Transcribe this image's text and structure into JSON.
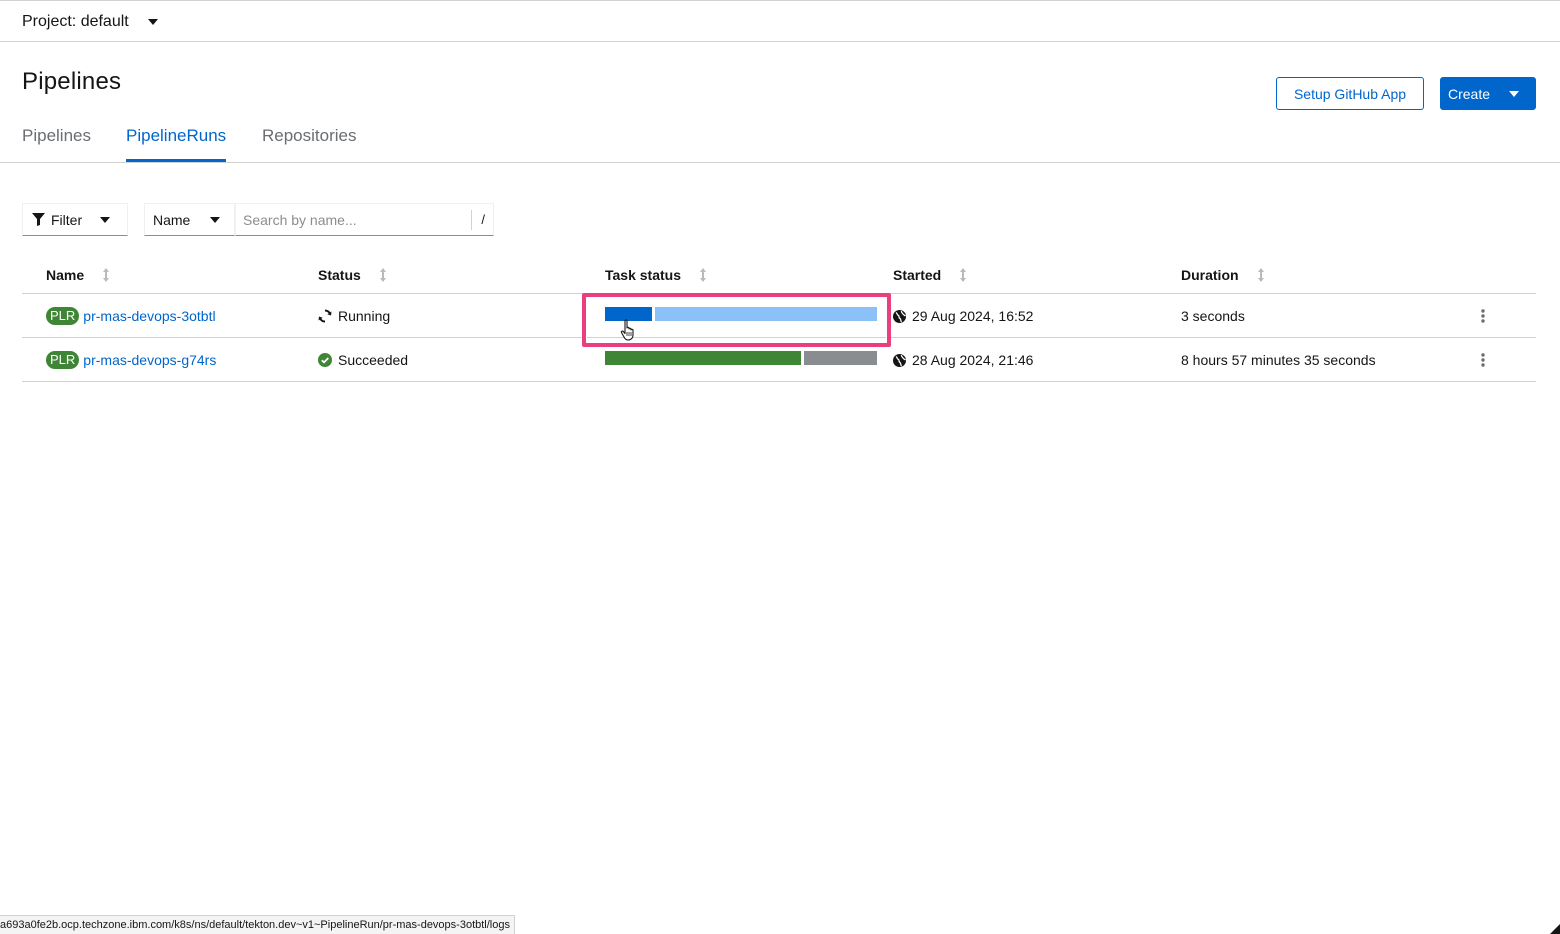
{
  "project": {
    "label": "Project: default"
  },
  "page": {
    "title": "Pipelines"
  },
  "actions": {
    "setup_github_label": "Setup GitHub App",
    "create_label": "Create"
  },
  "tabs": [
    {
      "label": "Pipelines",
      "active": false
    },
    {
      "label": "PipelineRuns",
      "active": true
    },
    {
      "label": "Repositories",
      "active": false
    }
  ],
  "toolbar": {
    "filter_label": "Filter",
    "name_select_value": "Name",
    "search_placeholder": "Search by name...",
    "search_shortcut": "/"
  },
  "table": {
    "columns": [
      "Name",
      "Status",
      "Task status",
      "Started",
      "Duration"
    ],
    "rows": [
      {
        "badge": "PLR",
        "name": "pr-mas-devops-3otbtl",
        "status": "Running",
        "status_icon": "sync-icon",
        "task_status": [
          {
            "state": "running",
            "fraction": 0.175,
            "color": "#0066cc"
          },
          {
            "state": "pending",
            "fraction": 0.825,
            "color": "#8bc1f7"
          }
        ],
        "started": "29 Aug 2024, 16:52",
        "duration": "3 seconds"
      },
      {
        "badge": "PLR",
        "name": "pr-mas-devops-g74rs",
        "status": "Succeeded",
        "status_icon": "check-circle-icon",
        "task_status": [
          {
            "state": "succeeded",
            "fraction": 0.73,
            "color": "#3e8635"
          },
          {
            "state": "skipped",
            "fraction": 0.27,
            "color": "#8a8d90"
          }
        ],
        "started": "28 Aug 2024, 21:46",
        "duration": "8 hours 57 minutes 35 seconds"
      }
    ]
  },
  "status_bar": {
    "url": "a693a0fe2b.ocp.techzone.ibm.com/k8s/ns/default/tekton.dev~v1~PipelineRun/pr-mas-devops-3otbtl/logs"
  },
  "colors": {
    "primary": "#0066cc",
    "success": "#3e8635",
    "highlight": "#e93f7e"
  }
}
